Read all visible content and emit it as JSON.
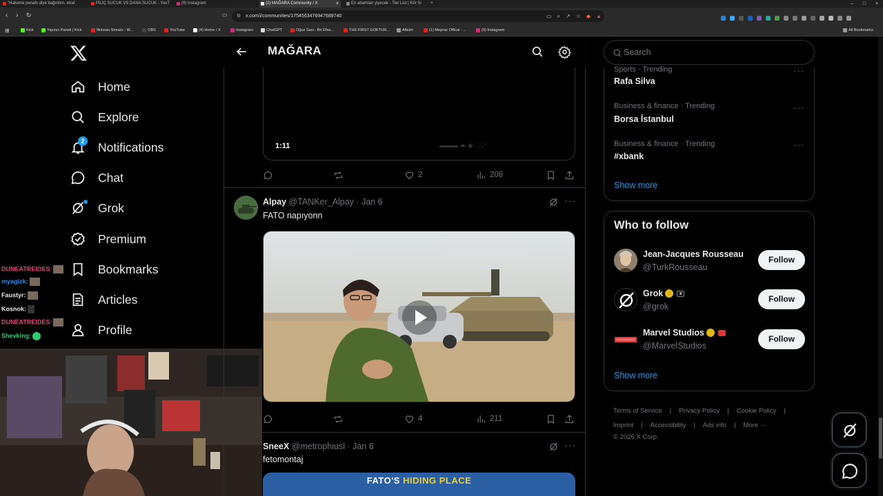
{
  "browser": {
    "tabs": [
      {
        "label": "\"Hakeme penaltı diye bağırdım, etraf",
        "color": "#e62117"
      },
      {
        "label": "PİLİÇ SUCUK VS DANA SUCUK - YouT",
        "color": "#e62117"
      },
      {
        "label": "(9) Instagram",
        "color": "#d62976"
      },
      {
        "label": "(2) MAĞARA Community / X",
        "color": "#ffffff"
      },
      {
        "label": "En abartılan yiyecek - Tier List | Kör Sı",
        "color": "#888888"
      }
    ],
    "url": "x.com/i/communities/1754563476947689740",
    "bookmarks": [
      "Kick",
      "Yayıncı Paneli | Kick",
      "İlkinsan Stream - W...",
      "OBS",
      "YouTube",
      "(4) Home / X",
      "Instagram",
      "ChatGPT",
      "Oğuz Sasi - Bir Efsa...",
      "THE FIRST GOKTUR...",
      "Albüm",
      "(1) Mepraz Offical - ...",
      "(9) Instagram"
    ],
    "all_bookmarks": "All Bookmarks"
  },
  "nav": {
    "items": [
      {
        "label": "Home",
        "icon": "home-icon"
      },
      {
        "label": "Explore",
        "icon": "search-icon"
      },
      {
        "label": "Notifications",
        "icon": "bell-icon"
      },
      {
        "label": "Chat",
        "icon": "chat-icon"
      },
      {
        "label": "Grok",
        "icon": "grok-icon"
      },
      {
        "label": "Premium",
        "icon": "premium-icon"
      },
      {
        "label": "Bookmarks",
        "icon": "bookmark-icon"
      },
      {
        "label": "Articles",
        "icon": "articles-icon"
      },
      {
        "label": "Profile",
        "icon": "profile-icon"
      }
    ],
    "notification_count": "2"
  },
  "stream_chat": [
    {
      "user": "DUNEATREIDES:",
      "color": "#e0457b"
    },
    {
      "user": "myagizk:",
      "color": "#1e90ff"
    },
    {
      "user": "Faustyr:",
      "color": "#e7e9ea"
    },
    {
      "user": "Kosnok:",
      "color": "#e7e9ea"
    },
    {
      "user": "DUNEATREIDES:",
      "color": "#e0457b"
    },
    {
      "user": "Shevking:",
      "color": "#2ecc71"
    }
  ],
  "header": {
    "title": "MAĞARA"
  },
  "post1": {
    "duration": "1:11",
    "likes": "2",
    "views": "208"
  },
  "post2": {
    "name": "Alpay",
    "handle": "@TANKer_Alpay · Jan 6",
    "text": "FATO napıyonn",
    "likes": "4",
    "views": "211"
  },
  "post3": {
    "name": "SneeX",
    "handle": "@metrophiusl · Jan 6",
    "text": "fetomontaj",
    "media_caption_a": "FATO'S",
    "media_caption_b": "HIDING PLACE"
  },
  "search": {
    "placeholder": "Search"
  },
  "trends": [
    {
      "category": "Sports · Trending",
      "name": "Rafa Silva"
    },
    {
      "category": "Business & finance · Trending",
      "name": "Borsa İstanbul"
    },
    {
      "category": "Business & finance · Trending",
      "name": "#xbank"
    }
  ],
  "show_more": "Show more",
  "who_to_follow": {
    "title": "Who to follow",
    "accounts": [
      {
        "name": "Jean-Jacques Rousseau",
        "handle": "@TurkRousseau",
        "button": "Follow"
      },
      {
        "name": "Grok",
        "handle": "@grok",
        "button": "Follow"
      },
      {
        "name": "Marvel Studios",
        "handle": "@MarvelStudios",
        "button": "Follow"
      }
    ],
    "show_more": "Show more"
  },
  "footer": {
    "links_row1": [
      "Terms of Service",
      "|",
      "Privacy Policy",
      "|",
      "Cookie Policy",
      "|"
    ],
    "links_row2": [
      "Imprint",
      "|",
      "Accessibility",
      "|",
      "Ads info",
      "|",
      "More ···"
    ],
    "copyright": "© 2026 X Corp."
  },
  "colors": {
    "accent": "#1d9bf0",
    "gold_badge": "#e2b719"
  }
}
